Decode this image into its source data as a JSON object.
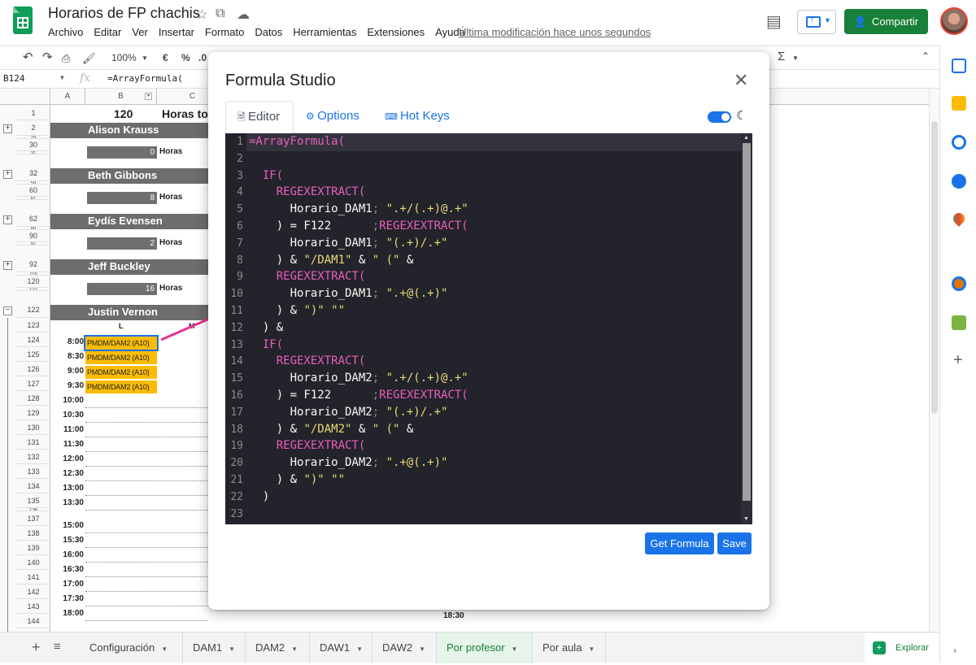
{
  "header": {
    "title": "Horarios de FP chachis",
    "menu": [
      "Archivo",
      "Editar",
      "Ver",
      "Insertar",
      "Formato",
      "Datos",
      "Herramientas",
      "Extensiones",
      "Ayuda"
    ],
    "last_edit": "Última modificación hace unos segundos",
    "share_label": "Compartir"
  },
  "toolbar": {
    "zoom": "100%",
    "currency": "€",
    "percent": "%",
    "decimal": ".0",
    "sum": "Σ"
  },
  "formula_bar": {
    "cell_ref": "B124",
    "fx": "fx",
    "content": "=ArrayFormula("
  },
  "grid": {
    "columns": [
      "A",
      "B",
      "C"
    ],
    "header_count": "120",
    "header_label": "Horas tota",
    "rows": [
      "1",
      "2",
      "29",
      "30",
      "31",
      "32",
      "59",
      "60",
      "61",
      "62",
      "89",
      "90",
      "91",
      "92",
      "119",
      "120",
      "121",
      "122",
      "123",
      "124",
      "125",
      "126",
      "127",
      "128",
      "129",
      "130",
      "131",
      "132",
      "133",
      "134",
      "135",
      "136",
      "137",
      "138",
      "139",
      "140",
      "141",
      "142",
      "143",
      "144"
    ],
    "teachers": [
      {
        "name": "Alison Krauss",
        "hours": "0",
        "hours_label": "Horas"
      },
      {
        "name": "Beth Gibbons",
        "hours": "8",
        "hours_label": "Horas"
      },
      {
        "name": "Eydís Evensen",
        "hours": "2",
        "hours_label": "Horas"
      },
      {
        "name": "Jeff Buckley",
        "hours": "16",
        "hours_label": "Horas"
      },
      {
        "name": "Justin Vernon"
      }
    ],
    "day_l": "L",
    "day_m": "M",
    "times": [
      "8:00",
      "8:30",
      "9:00",
      "9:30",
      "10:00",
      "10:30",
      "11:00",
      "11:30",
      "12:00",
      "12:30",
      "13:00",
      "13:30",
      "15:00",
      "15:30",
      "16:00",
      "16:30",
      "17:00",
      "17:30",
      "18:00"
    ],
    "class_entry": "PMDM/DAM2 (A10)",
    "end_time": "18:30"
  },
  "sheet_tabs": [
    "Configuración",
    "DAM1",
    "DAM2",
    "DAW1",
    "DAW2",
    "Por profesor",
    "Por aula"
  ],
  "active_tab": "Por profesor",
  "explore_label": "Explorar",
  "dialog": {
    "title": "Formula Studio",
    "tabs": {
      "editor": "Editor",
      "options": "Options",
      "hotkeys": "Hot Keys"
    },
    "get_formula": "Get Formula",
    "save": "Save"
  },
  "code_lines": [
    [
      {
        "t": "=ArrayFormula(",
        "c": "kw"
      }
    ],
    [],
    [
      {
        "t": "  IF(",
        "c": "kw"
      }
    ],
    [
      {
        "t": "    REGEXEXTRACT(",
        "c": "kw"
      }
    ],
    [
      {
        "t": "      Horario_DAM1"
      },
      {
        "t": "; ",
        "c": "sep"
      },
      {
        "t": "\".+/(.+)@.+\"",
        "c": "str"
      }
    ],
    [
      {
        "t": "    ) = F122      "
      },
      {
        "t": ";",
        "c": "sep"
      },
      {
        "t": "REGEXEXTRACT(",
        "c": "kw"
      }
    ],
    [
      {
        "t": "      Horario_DAM1"
      },
      {
        "t": "; ",
        "c": "sep"
      },
      {
        "t": "\"(.+)/.+\"",
        "c": "str"
      }
    ],
    [
      {
        "t": "    ) & "
      },
      {
        "t": "\"/DAM1\"",
        "c": "str"
      },
      {
        "t": " & "
      },
      {
        "t": "\" (\"",
        "c": "str"
      },
      {
        "t": " &"
      }
    ],
    [
      {
        "t": "    REGEXEXTRACT(",
        "c": "kw"
      }
    ],
    [
      {
        "t": "      Horario_DAM1"
      },
      {
        "t": "; ",
        "c": "sep"
      },
      {
        "t": "\".+@(.+)\"",
        "c": "str"
      }
    ],
    [
      {
        "t": "    ) & "
      },
      {
        "t": "\")\"",
        "c": "str"
      },
      {
        "t": " "
      },
      {
        "t": "\"\"",
        "c": "str"
      }
    ],
    [
      {
        "t": "  ) &"
      }
    ],
    [
      {
        "t": "  IF(",
        "c": "kw"
      }
    ],
    [
      {
        "t": "    REGEXEXTRACT(",
        "c": "kw"
      }
    ],
    [
      {
        "t": "      Horario_DAM2"
      },
      {
        "t": "; ",
        "c": "sep"
      },
      {
        "t": "\".+/(.+)@.+\"",
        "c": "str"
      }
    ],
    [
      {
        "t": "    ) = F122      "
      },
      {
        "t": ";",
        "c": "sep"
      },
      {
        "t": "REGEXEXTRACT(",
        "c": "kw"
      }
    ],
    [
      {
        "t": "      Horario_DAM2"
      },
      {
        "t": "; ",
        "c": "sep"
      },
      {
        "t": "\"(.+)/.+\"",
        "c": "str"
      }
    ],
    [
      {
        "t": "    ) & "
      },
      {
        "t": "\"/DAM2\"",
        "c": "str"
      },
      {
        "t": " & "
      },
      {
        "t": "\" (\"",
        "c": "str"
      },
      {
        "t": " &"
      }
    ],
    [
      {
        "t": "    REGEXEXTRACT(",
        "c": "kw"
      }
    ],
    [
      {
        "t": "      Horario_DAM2"
      },
      {
        "t": "; ",
        "c": "sep"
      },
      {
        "t": "\".+@(.+)\"",
        "c": "str"
      }
    ],
    [
      {
        "t": "    ) & "
      },
      {
        "t": "\")\"",
        "c": "str"
      },
      {
        "t": " "
      },
      {
        "t": "\"\"",
        "c": "str"
      }
    ],
    [
      {
        "t": "  )"
      }
    ],
    []
  ],
  "colors": {
    "accent": "#1a73e8",
    "share": "#188038",
    "editor_bg": "#23232b",
    "keyword": "#e95fbb",
    "string": "#e6db74",
    "class_cell": "#fbbc04",
    "arrow": "#e8318e"
  }
}
